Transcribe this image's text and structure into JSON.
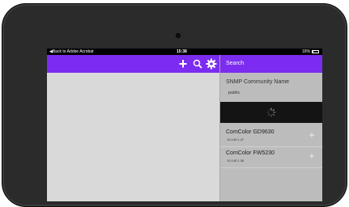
{
  "status_bar": {
    "back_label": "◀Back to Adobe Acrobat",
    "time": "15:38",
    "battery_text": "16%"
  },
  "toolbar": {
    "icons": [
      "plus-icon",
      "search-icon",
      "gear-icon"
    ],
    "accent_color": "#7b2cf0"
  },
  "sidebar": {
    "header_title": "Search",
    "community_label": "SNMP Community Name",
    "community_value": "public",
    "devices": [
      {
        "name": "ComColor GD9630",
        "ip": "10.140.1.47"
      },
      {
        "name": "ComColor FW5230",
        "ip": "10.140.1.38"
      }
    ]
  }
}
